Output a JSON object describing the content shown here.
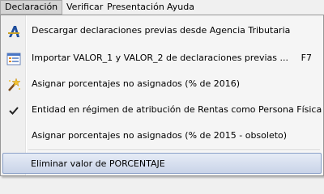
{
  "menubar": {
    "items": [
      {
        "label": "Declaración"
      },
      {
        "label": "Verificar"
      },
      {
        "label": "Presentación"
      },
      {
        "label": "Ayuda"
      }
    ]
  },
  "menu": {
    "items": [
      {
        "label": "Descargar declaraciones previas desde Agencia Tributaria",
        "icon": "aeat-logo-icon",
        "shortcut": ""
      },
      {
        "label": "Importar VALOR_1 y VALOR_2 de declaraciones previas ...",
        "icon": "import-list-icon",
        "shortcut": "F7"
      },
      {
        "label": "Asignar porcentajes no asignados (% de 2016)",
        "icon": "magic-wand-icon",
        "shortcut": ""
      },
      {
        "label": "Entidad en régimen de atribución de Rentas como Persona Física",
        "icon": "checkmark-icon",
        "checked": true,
        "shortcut": ""
      },
      {
        "label": "Asignar porcentajes no asignados (% de 2015 - obsoleto)",
        "icon": "",
        "shortcut": ""
      },
      {
        "label": "Eliminar valor de PORCENTAJE",
        "icon": "",
        "shortcut": "",
        "highlighted": true
      }
    ]
  }
}
